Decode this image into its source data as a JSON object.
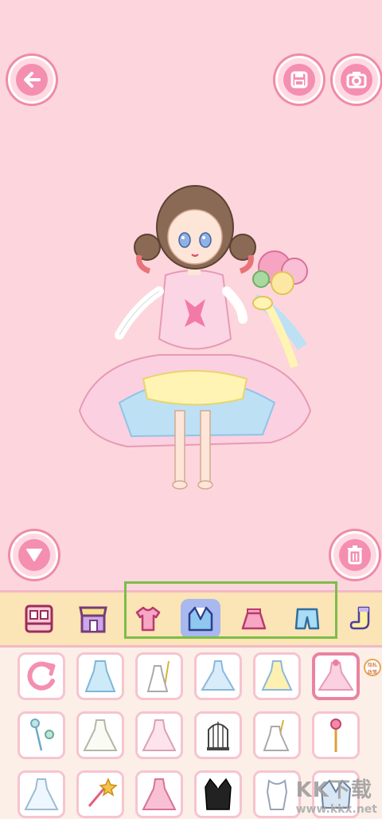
{
  "toolbar": {
    "back": "back",
    "save": "save",
    "camera": "camera",
    "hide": "hide",
    "delete": "delete"
  },
  "categories": [
    {
      "name": "wardrobe",
      "selected": false
    },
    {
      "name": "shop",
      "selected": false
    },
    {
      "name": "tops",
      "selected": false
    },
    {
      "name": "outerwear",
      "selected": true
    },
    {
      "name": "skirts",
      "selected": false
    },
    {
      "name": "shorts",
      "selected": false
    },
    {
      "name": "socks",
      "selected": false
    }
  ],
  "colors": {
    "background": "#fcd6dc",
    "accent": "#f48fb1",
    "highlight_frame": "#7cbd4a",
    "category_bar": "#fbe4b5"
  },
  "privacy_badge": {
    "line1": "隐私",
    "line2": "政策"
  },
  "watermark": {
    "main": "KK下载",
    "sub": "www.kkx.net"
  },
  "items": [
    {
      "name": "reset-item"
    },
    {
      "name": "blue-dress-item"
    },
    {
      "name": "white-dress-item"
    },
    {
      "name": "blue-ball-gown-item"
    },
    {
      "name": "yellow-dress-item"
    },
    {
      "name": "pink-ball-gown-item"
    },
    {
      "name": "wand-item"
    },
    {
      "name": "white-gown-item"
    },
    {
      "name": "pink-gown-item"
    },
    {
      "name": "cage-item"
    },
    {
      "name": "white-frill-dress-item"
    },
    {
      "name": "crown-staff-item"
    },
    {
      "name": "lace-dress-item"
    },
    {
      "name": "candy-wand-item"
    },
    {
      "name": "pink-frill-dress-item"
    },
    {
      "name": "tuxedo-item"
    },
    {
      "name": "blue-dress-2-item"
    },
    {
      "name": "jacket-item"
    }
  ]
}
